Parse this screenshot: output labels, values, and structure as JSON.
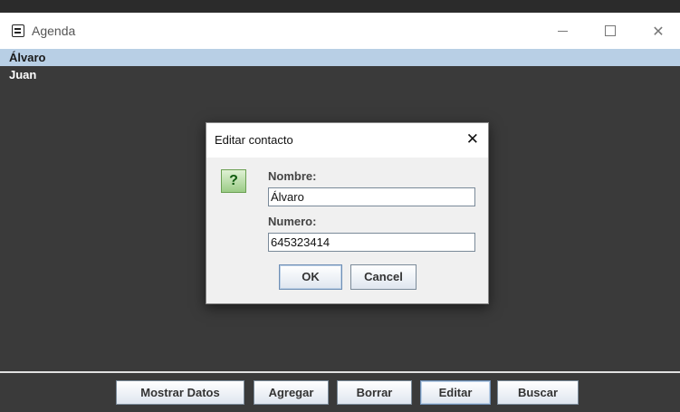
{
  "window": {
    "title": "Agenda",
    "close_glyph": "✕"
  },
  "contacts": [
    {
      "name": "Álvaro",
      "selected": true
    },
    {
      "name": "Juan",
      "selected": false
    }
  ],
  "toolbar": {
    "show_label": "Mostrar Datos",
    "add_label": "Agregar",
    "delete_label": "Borrar",
    "edit_label": "Editar",
    "search_label": "Buscar"
  },
  "dialog": {
    "title": "Editar contacto",
    "close_glyph": "✕",
    "icon_glyph": "?",
    "name_label": "Nombre:",
    "name_value": "Álvaro",
    "number_label": "Numero:",
    "number_value": "645323414",
    "ok_label": "OK",
    "cancel_label": "Cancel"
  },
  "colors": {
    "background": "#3a3a3a",
    "selection": "#b8cfe5",
    "dialog": "#f0f0f0",
    "question_icon": "#9bcc86"
  },
  "icons": [
    "contacts-app-icon",
    "minimize-icon",
    "maximize-icon",
    "close-icon",
    "dialog-close-icon",
    "question-icon"
  ]
}
